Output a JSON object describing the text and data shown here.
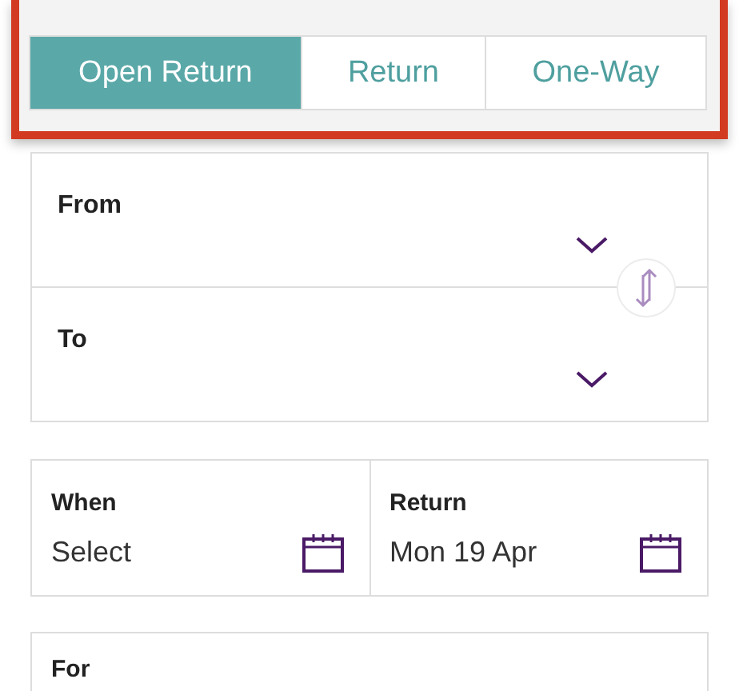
{
  "tabs": [
    {
      "label": "Open Return",
      "selected": true
    },
    {
      "label": "Return",
      "selected": false
    },
    {
      "label": "One-Way",
      "selected": false
    }
  ],
  "route": [
    {
      "label": "From"
    },
    {
      "label": "To"
    }
  ],
  "dates": [
    {
      "label": "When",
      "value": "Select"
    },
    {
      "label": "Return",
      "value": "Mon 19 Apr"
    }
  ],
  "passengers": {
    "label": "For"
  }
}
